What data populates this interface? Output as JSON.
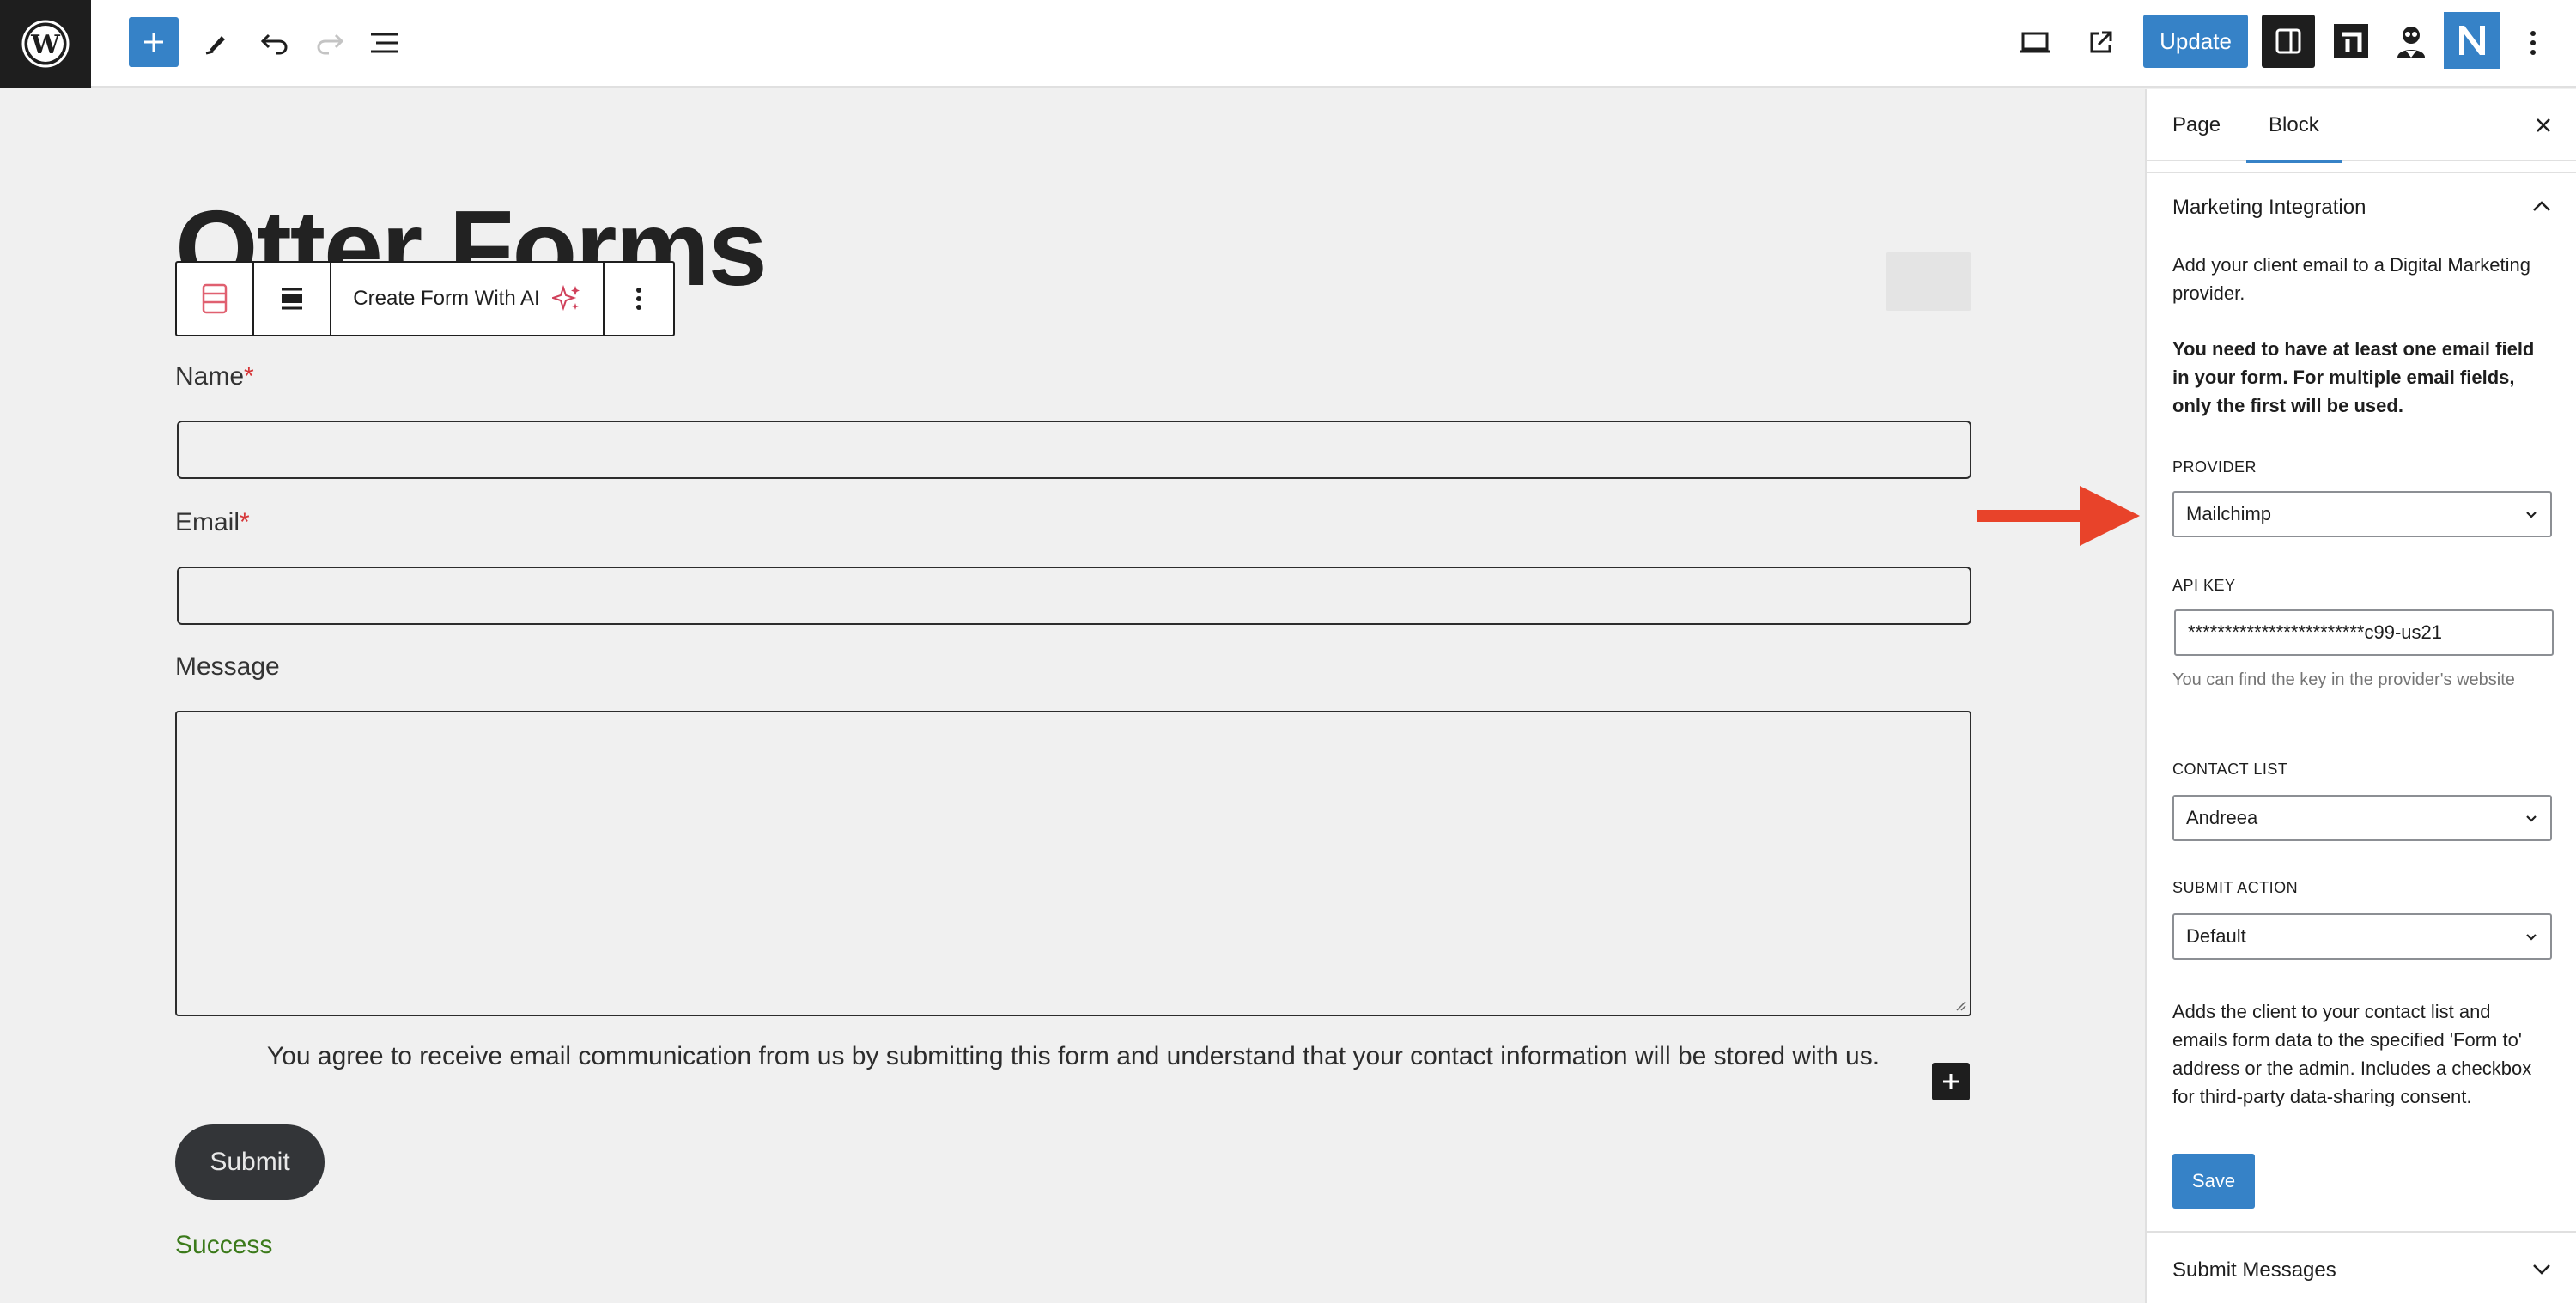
{
  "topbar": {
    "update_label": "Update",
    "icons": [
      "wordpress-icon",
      "plus-icon",
      "pencil-icon",
      "undo-icon",
      "redo-icon",
      "list-view-icon",
      "desktop-icon",
      "external-link-icon",
      "sidebar-icon",
      "plugin-otter-icon",
      "plugin-user-icon",
      "plugin-n-icon",
      "more-vertical-icon"
    ]
  },
  "canvas": {
    "page_title": "Otter Forms",
    "toolbar": {
      "create_form_label": "Create Form With AI"
    },
    "fields": [
      {
        "label": "Name",
        "required_mark": "*"
      },
      {
        "label": "Email",
        "required_mark": "*"
      },
      {
        "label": "Message",
        "required_mark": ""
      }
    ],
    "consent_text": "You agree to receive email communication from us by submitting this form and understand that your contact information will be stored with us.",
    "submit_label": "Submit",
    "success_label": "Success"
  },
  "sidebar": {
    "tabs": [
      {
        "label": "Page",
        "active": false
      },
      {
        "label": "Block",
        "active": true
      }
    ],
    "panel_title": "Marketing Integration",
    "intro_text": "Add your client email to a Digital Marketing provider.",
    "warning_text": "You need to have at least one email field in your form. For multiple email fields, only the first will be used.",
    "provider": {
      "label": "PROVIDER",
      "value": "Mailchimp"
    },
    "api_key": {
      "label": "API KEY",
      "value": "************************c99-us21",
      "help": "You can find the key in the provider's website"
    },
    "contact_list": {
      "label": "CONTACT LIST",
      "value": "Andreea"
    },
    "submit_action": {
      "label": "SUBMIT ACTION",
      "value": "Default"
    },
    "action_description": "Adds the client to your contact list and emails form data to the specified 'Form to' address or the admin. Includes a checkbox for third-party data-sharing consent.",
    "save_label": "Save",
    "next_panel_title": "Submit Messages"
  },
  "colors": {
    "accent": "#3682c7",
    "arrow": "#e8432a",
    "required": "#d63638",
    "success": "#3b7a1a"
  }
}
